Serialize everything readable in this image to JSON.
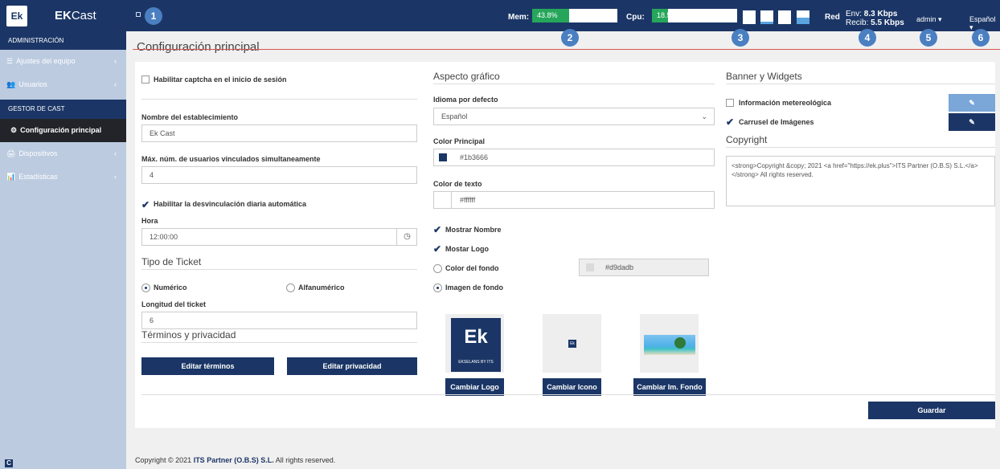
{
  "brand": {
    "logo": "Ek",
    "title_bold": "EK",
    "title_rest": "Cast"
  },
  "badges": [
    "1",
    "2",
    "3",
    "4",
    "5",
    "6"
  ],
  "topbar": {
    "mem_label": "Mem:",
    "mem_value": "43.8%",
    "mem_fraction": 0.438,
    "cpu_label": "Cpu:",
    "cpu_value": "18.5%",
    "cpu_fraction": 0.185,
    "net_label": "Red",
    "env_label": "Env:",
    "env_value": "8.3 Kbps",
    "recib_label": "Recib:",
    "recib_value": "5.5 Kbps",
    "user": "admin ▾",
    "language": "Español ▾"
  },
  "sidebar": {
    "section1": "ADMINISTRACIÓN",
    "items1": [
      {
        "icon": "☰",
        "label": "Ajustes del equipo"
      },
      {
        "icon": "👥",
        "label": "Usuarios"
      }
    ],
    "section2": "GESTOR DE CAST",
    "active": {
      "icon": "⚙",
      "label": "Configuración principal"
    },
    "items2": [
      {
        "icon": "🖨",
        "label": "Dispositivos"
      },
      {
        "icon": "📊",
        "label": "Estadísticas"
      }
    ],
    "bottom_icon": "C"
  },
  "page": {
    "title": "Configuración principal"
  },
  "col1": {
    "captcha": "Habilitar captcha en el inicio de sesión",
    "name_label": "Nombre del establecimiento",
    "name_value": "Ek Cast",
    "max_label": "Máx. núm. de usuarios vinculados simultaneamente",
    "max_value": "4",
    "unlink": "Habilitar la desvinculación diaria automática",
    "hour_label": "Hora",
    "hour_value": "12:00:00",
    "ticket_title": "Tipo de Ticket",
    "ticket_numeric": "Numérico",
    "ticket_alpha": "Alfanumérico",
    "length_label": "Longitud del ticket",
    "length_value": "6",
    "terms_title": "Términos y privacidad",
    "edit_terms": "Editar términos",
    "edit_privacy": "Editar privacidad"
  },
  "col2": {
    "title": "Aspecto gráfico",
    "lang_label": "Idioma por defecto",
    "lang_value": "Español",
    "main_color_label": "Color Principal",
    "main_color": "#1b3666",
    "text_color_label": "Color de texto",
    "text_color": "#ffffff",
    "show_name": "Mostrar Nombre",
    "show_logo": "Mostar Logo",
    "bg_color_label": "Color del fondo",
    "bg_color": "#d9dadb",
    "bg_image_label": "Imagen de fondo",
    "logo_text": "Ek",
    "logo_sub": "EKSELANS BY ITS",
    "small_icon": "Ek",
    "change_logo": "Cambiar Logo",
    "change_icon": "Cambiar Icono",
    "change_bg": "Cambiar Im. Fondo"
  },
  "col3": {
    "title": "Banner y Widgets",
    "weather": "Información metereológica",
    "carousel": "Carrusel de Imágenes",
    "copyright_title": "Copyright",
    "copyright_text": "<strong>Copyright &copy; 2021 <a href=\"https://ek.plus\">ITS Partner (O.B.S) S.L.</a></strong> All rights reserved."
  },
  "save": "Guardar",
  "footer": {
    "prefix": "Copyright © 2021 ",
    "company": "ITS Partner (O.B.S) S.L.",
    "suffix": " All rights reserved."
  }
}
